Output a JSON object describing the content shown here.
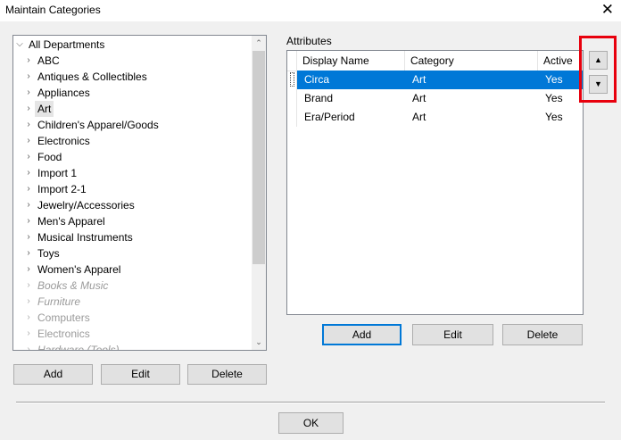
{
  "window": {
    "title": "Maintain Categories",
    "close_glyph": "✕"
  },
  "tree": {
    "root": "All Departments",
    "items": [
      {
        "label": "ABC"
      },
      {
        "label": "Antiques & Collectibles"
      },
      {
        "label": "Appliances"
      },
      {
        "label": "Art"
      },
      {
        "label": "Children's Apparel/Goods"
      },
      {
        "label": "Electronics"
      },
      {
        "label": "Food"
      },
      {
        "label": "Import 1"
      },
      {
        "label": "Import 2-1"
      },
      {
        "label": "Jewelry/Accessories"
      },
      {
        "label": "Men's Apparel"
      },
      {
        "label": "Musical Instruments"
      },
      {
        "label": "Toys"
      },
      {
        "label": "Women's Apparel"
      },
      {
        "label": "Books & Music"
      },
      {
        "label": "Furniture"
      },
      {
        "label": "Computers"
      },
      {
        "label": "Electronics"
      },
      {
        "label": "Hardware (Tools)"
      }
    ],
    "selected": "Art"
  },
  "left_buttons": {
    "add": "Add",
    "edit": "Edit",
    "delete": "Delete"
  },
  "attributes": {
    "label": "Attributes",
    "columns": [
      "Display Name",
      "Category",
      "Active"
    ],
    "rows": [
      {
        "name": "Circa",
        "category": "Art",
        "active": "Yes"
      },
      {
        "name": "Brand",
        "category": "Art",
        "active": "Yes"
      },
      {
        "name": "Era/Period",
        "category": "Art",
        "active": "Yes"
      }
    ],
    "selected_row": "Circa"
  },
  "attr_buttons": {
    "add": "Add",
    "edit": "Edit",
    "delete": "Delete"
  },
  "move_buttons": {
    "up_icon": "▲",
    "down_icon": "▼"
  },
  "ok_button": "OK",
  "highlight_color": "#e8000d",
  "accent_color": "#0078d7"
}
